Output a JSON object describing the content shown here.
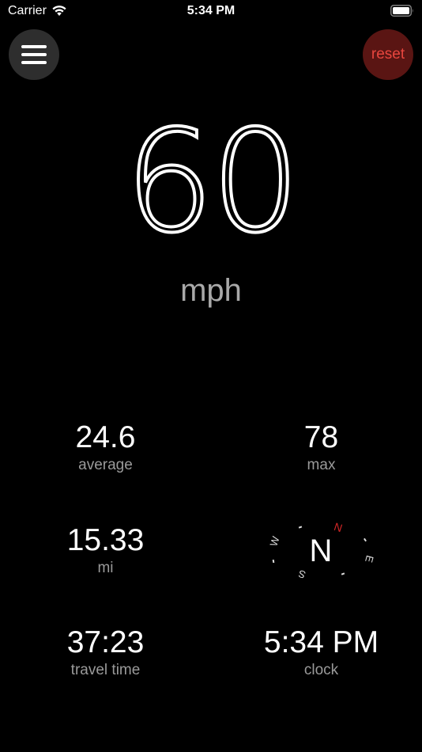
{
  "status_bar": {
    "carrier": "Carrier",
    "time": "5:34 PM"
  },
  "controls": {
    "reset_label": "reset"
  },
  "speed": {
    "value": "60",
    "unit": "mph"
  },
  "stats": {
    "average": {
      "value": "24.6",
      "label": "average"
    },
    "max": {
      "value": "78",
      "label": "max"
    },
    "distance": {
      "value": "15.33",
      "label": "mi"
    },
    "travel_time": {
      "value": "37:23",
      "label": "travel time"
    },
    "clock": {
      "value": "5:34 PM",
      "label": "clock"
    }
  },
  "compass": {
    "heading": "N",
    "directions": {
      "north": "N",
      "west": "W",
      "east": "E",
      "south": "S"
    }
  },
  "colors": {
    "background": "#000000",
    "reset_background": "#5a1513",
    "reset_text": "#e8463e",
    "label_gray": "#9a9a9a",
    "compass_north": "#d32626"
  }
}
